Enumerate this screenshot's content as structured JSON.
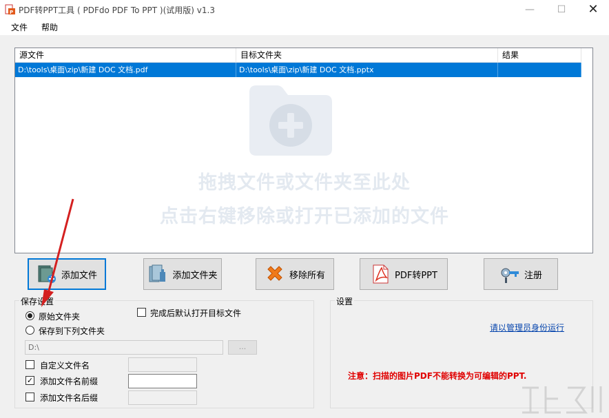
{
  "window": {
    "title": "PDF转PPT工具 ( PDFdo PDF To PPT )(试用版) v1.3",
    "min_glyph": "—",
    "max_glyph": "☐",
    "close_glyph": "✕"
  },
  "menu": {
    "file": "文件",
    "help": "帮助"
  },
  "file_list": {
    "columns": {
      "source": "源文件",
      "target": "目标文件夹",
      "result": "结果"
    },
    "rows": [
      {
        "source": "D:\\tools\\桌面\\zip\\新建 DOC 文档.pdf",
        "target": "D:\\tools\\桌面\\zip\\新建 DOC 文档.pptx",
        "result": ""
      }
    ],
    "hint_line1": "拖拽文件或文件夹至此处",
    "hint_line2": "点击右键移除或打开已添加的文件"
  },
  "toolbar": {
    "add_file": "添加文件",
    "add_folder": "添加文件夹",
    "remove_all": "移除所有",
    "convert": "PDF转PPT",
    "register": "注册"
  },
  "save_settings": {
    "title": "保存设置",
    "original_folder": "原始文件夹",
    "save_to_folder": "保存到下列文件夹",
    "open_after": "完成后默认打开目标文件",
    "path_value": "D:\\",
    "browse_label": "...",
    "custom_name": "自定义文件名",
    "add_prefix": "添加文件名前缀",
    "add_suffix": "添加文件名后缀",
    "selected_radio": "original_folder",
    "prefix_checked": true
  },
  "settings": {
    "title": "设置",
    "admin_link": "请以管理员身份运行",
    "notice": "注意：扫描的图片PDF不能转换为可编辑的PPT."
  },
  "colors": {
    "selection": "#0078d7",
    "notice": "#e00000",
    "link": "#0645ad",
    "arrow": "#d42020"
  }
}
